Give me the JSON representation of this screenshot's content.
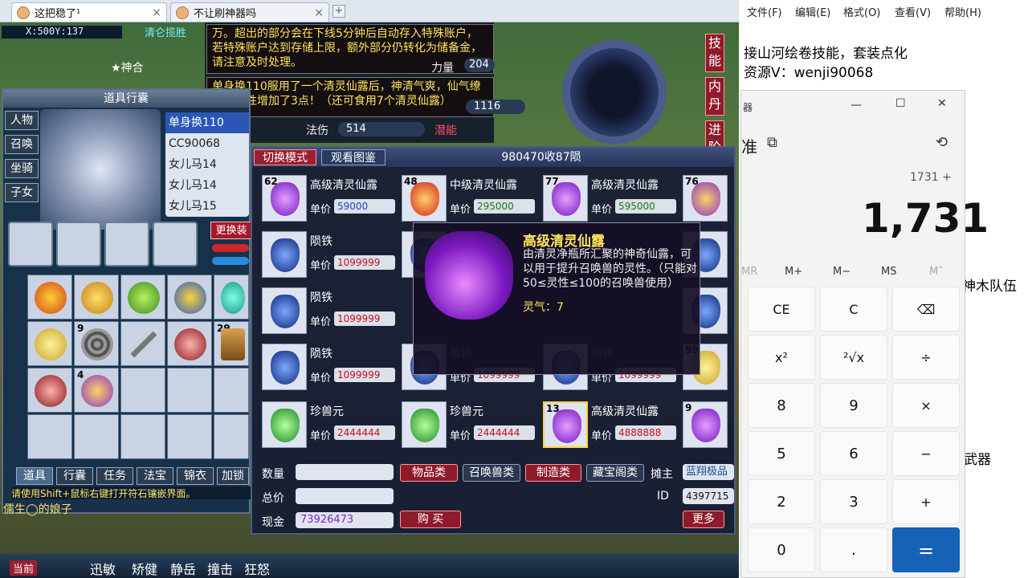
{
  "browser": {
    "tabs": [
      {
        "title": "这把稳了¹",
        "close": "×"
      },
      {
        "title": "不让刷神器吗",
        "close": "×"
      }
    ],
    "new_tab": "+"
  },
  "game": {
    "coords": "X:500Y:137",
    "top_labels": [
      "清仑揽胜",
      "★神合"
    ],
    "stats_notice_1": "万。超出的部分会在下线5分钟后自动存入特殊账户，若特殊账户达到存储上限，额外部分仍转化为储备金，请注意及时处理。",
    "stats_notice_2": "单身换110服用了一个清灵仙露后，神清气爽，仙气缭绕，灵性增加了3点！（还可食用7个清灵仙露）",
    "stats": [
      {
        "label": "力量",
        "value": "204"
      },
      {
        "label": "法伤",
        "value": "514"
      },
      {
        "label": "潜能",
        "value": "1116"
      }
    ],
    "side_buttons": [
      "技能",
      "内丹",
      "进阶"
    ],
    "bag": {
      "title": "道具行囊",
      "tabs": [
        "人物",
        "召唤",
        "坐骑",
        "子女"
      ],
      "pets": [
        "单身换110",
        "CC90068",
        "女儿马14",
        "女儿马14",
        "女儿马15"
      ],
      "change_button": "更换装",
      "slots": [
        {
          "count": ""
        },
        {
          "count": ""
        },
        {
          "count": ""
        },
        {
          "count": ""
        },
        {
          "count": ""
        },
        {
          "count": ""
        },
        {
          "count": "9"
        },
        {
          "count": ""
        },
        {
          "count": ""
        },
        {
          "count": "29"
        },
        {
          "count": ""
        },
        {
          "count": "4"
        }
      ],
      "bottom_tabs": [
        "道具",
        "行囊",
        "任务",
        "法宝",
        "锦衣",
        "加锁"
      ],
      "hint": "请使用Shift+鼠标右键打开符石镶嵌界面。"
    },
    "player_name": "儒生◯的娘子",
    "shop": {
      "mode_button": "切换模式",
      "view_button": "观看图鉴",
      "header_info": "980470收87陨",
      "price_label": "单价",
      "items": [
        {
          "count": "62",
          "name": "高级清灵仙露",
          "price": "59000"
        },
        {
          "count": "48",
          "name": "中级清灵仙露",
          "price": "295000"
        },
        {
          "count": "77",
          "name": "高级清灵仙露",
          "price": "595000"
        },
        {
          "count": "76",
          "name": "",
          "price": ""
        },
        {
          "count": "",
          "name": "陨铁",
          "price": "1099999"
        },
        {
          "count": "",
          "name": "陨铁",
          "price": "1099999"
        },
        {
          "count": "",
          "name": "陨铁",
          "price": "1099999"
        },
        {
          "count": "",
          "name": "陨铁",
          "price": "1099999"
        },
        {
          "count": "",
          "name": "陨铁",
          "price": "1099999"
        },
        {
          "count": "99",
          "name": "",
          "price": ""
        },
        {
          "count": "",
          "name": "珍兽元",
          "price": "2444444"
        },
        {
          "count": "",
          "name": "珍兽元",
          "price": "2444444"
        },
        {
          "count": "13",
          "name": "高级清灵仙露",
          "price": "4888888"
        },
        {
          "count": "9",
          "name": "",
          "price": ""
        }
      ],
      "quantity_label": "数量",
      "total_label": "总价",
      "cash_label": "现金",
      "cash_value": "73926473",
      "buy_button": "购 买",
      "categories": [
        "物品类",
        "召唤兽类",
        "制造类",
        "藏宝阁类"
      ],
      "owner_label": "摊主",
      "owner_value": "蓝翔极品",
      "id_label": "ID",
      "id_value": "4397715",
      "more_button": "更多"
    },
    "tooltip": {
      "title": "高级清灵仙露",
      "desc": "由清灵净瓶所汇聚的神奇仙露，可以用于提升召唤兽的灵性。（只能对50≤灵性≤100的召唤兽使用）",
      "spirit": "灵气：7"
    },
    "bottom_bar": [
      "当前",
      "迅敏",
      "矫健",
      "静岳",
      "撞击",
      "狂怒"
    ]
  },
  "notepad": {
    "menu": [
      "文件(F)",
      "编辑(E)",
      "格式(O)",
      "查看(V)",
      "帮助(H)"
    ],
    "lines": [
      "接山河绘卷技能，套装点化",
      "资源V：wenji90068"
    ],
    "right_fragments": [
      "神木队伍",
      "武器"
    ]
  },
  "calculator": {
    "title_fragment": "器",
    "mode": "准",
    "expression": "1731 +",
    "display": "1,731",
    "memory": [
      "MR",
      "M+",
      "M−",
      "MS",
      "M˅"
    ],
    "keys": [
      "CE",
      "C",
      "⌫",
      "x²",
      "²√x",
      "÷",
      "8",
      "9",
      "×",
      "5",
      "6",
      "−",
      "2",
      "3",
      "+",
      "0",
      ".",
      "="
    ],
    "window_controls": [
      "—",
      "☐",
      "✕"
    ]
  }
}
